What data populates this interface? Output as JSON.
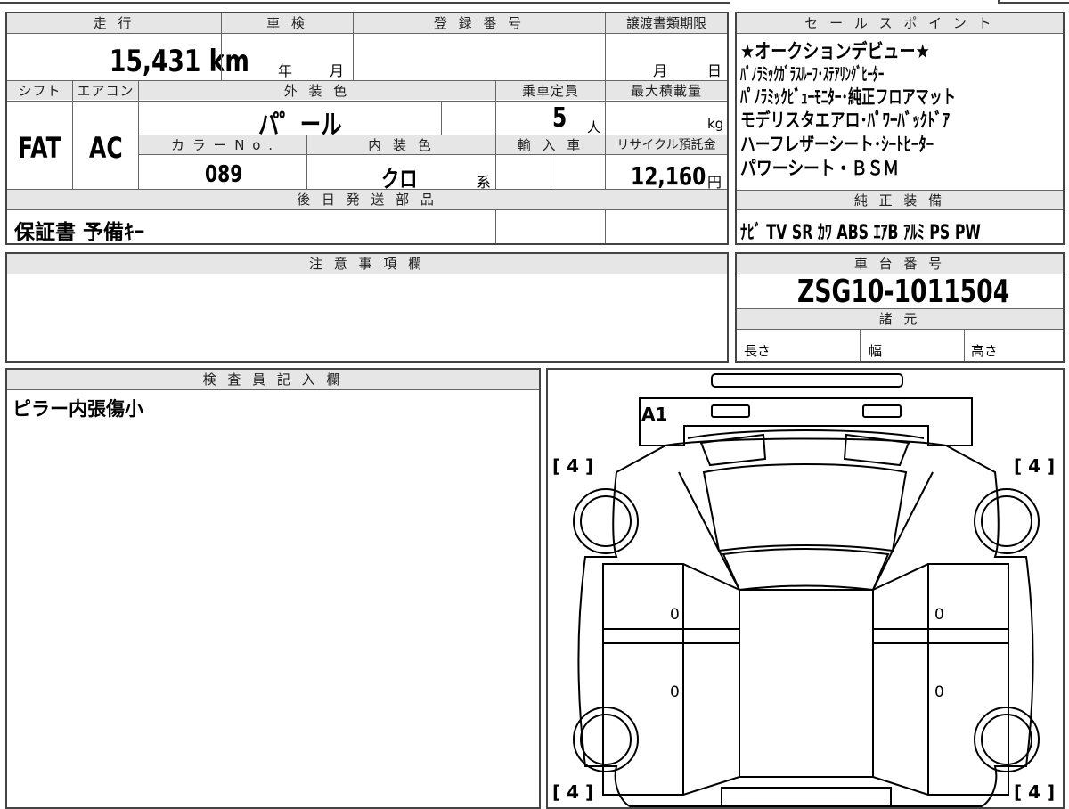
{
  "headers": {
    "mileage": "走 行",
    "inspection": "車 検",
    "registration": "登 録 番 号",
    "transfer_deadline": "譲渡書類期限",
    "shift": "シフト",
    "aircon": "エアコン",
    "exterior_color": "外 装 色",
    "capacity": "乗車定員",
    "max_load": "最大積載量",
    "color_no": "カ ラ ー N o .",
    "interior_color": "内 装 色",
    "import": "輸 入 車",
    "recycle": "リサイクル預託金",
    "shipping_parts": "後 日 発 送 部 品",
    "sales_points": "セ ー ル ス ポ イ ン ト",
    "equipment": "純 正 装 備",
    "notes": "注 意 事 項 欄",
    "chassis": "車 台 番 号",
    "specs": "諸 元",
    "inspector": "検 査 員 記 入 欄"
  },
  "values": {
    "mileage": "15,431 km",
    "year_unit": "年",
    "month_unit": "月",
    "day_unit": "日",
    "shift": "FAT",
    "aircon": "AC",
    "exterior_color": "パ゜ール",
    "capacity": "5",
    "capacity_unit": "人",
    "load_unit": "kg",
    "color_no": "089",
    "interior_color": "クロ",
    "interior_suffix": "系",
    "recycle": "12,160",
    "recycle_unit": "円",
    "shipping_parts": "保証書 予備ｷｰ",
    "chassis": "ZSG10-1011504",
    "length_label": "長さ",
    "width_label": "幅",
    "height_label": "高さ",
    "inspector_note": "ピラー内張傷小"
  },
  "sales_points": [
    "★オークションデビュー★",
    "ﾊﾟﾉﾗﾐｯｸｶﾞﾗｽﾙｰﾌ･ｽﾃｱﾘﾝｸﾞﾋｰﾀｰ",
    "ﾊﾟﾉﾗﾐｯｸﾋﾞｭｰﾓﾆﾀｰ･純正フロアマット",
    "モデリスタエアロ･ﾊﾟﾜｰﾊﾞｯｸﾄﾞｱ",
    "ハーフレザーシート･ｼｰﾄﾋｰﾀｰ",
    "パワーシート・ＢＳＭ"
  ],
  "equipment": "ﾅﾋﾞ TV SR ｶﾜ ABS ｴｱB ｱﾙﾐ PS PW",
  "diagram": {
    "mark_a1": "A1",
    "tire_tl": "[ 4 ]",
    "tire_tr": "[ 4 ]",
    "tire_bl": "[ 4 ]",
    "tire_br": "[ 4 ]",
    "door_l1": "0",
    "door_l2": "0",
    "door_r1": "0",
    "door_r2": "0"
  }
}
